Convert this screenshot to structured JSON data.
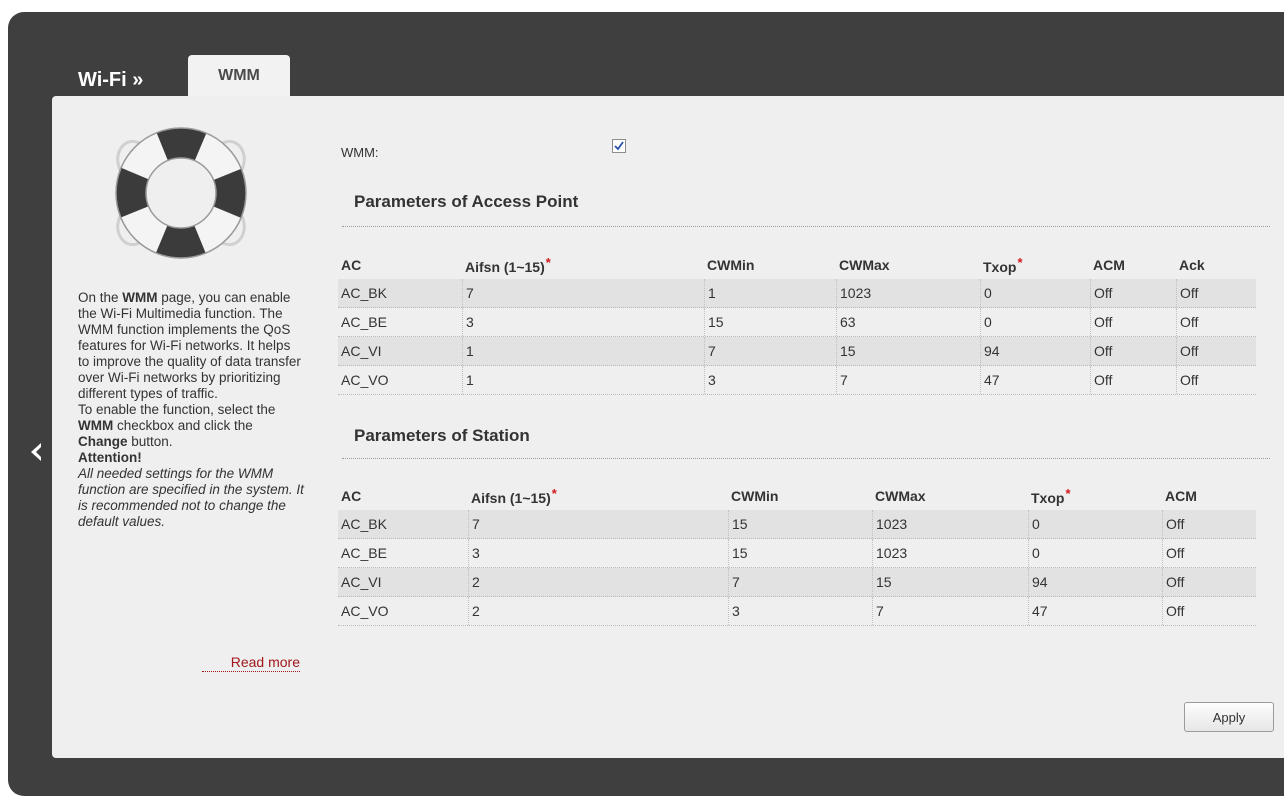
{
  "breadcrumb": {
    "parent": "Wi-Fi »",
    "current_tab": "WMM"
  },
  "help": {
    "p1_before": "On the ",
    "p1_bold": "WMM",
    "p1_after": " page, you can enable the Wi-Fi Multimedia function. The WMM function implements the QoS features for Wi-Fi networks. It helps to improve the quality of data transfer over Wi-Fi networks by prioritizing different types of traffic.",
    "p2_a": "To enable the function, select the ",
    "p2_b": "WMM",
    "p2_c": " checkbox and click the ",
    "p2_d": "Change",
    "p2_e": " button.",
    "attention": "Attention!",
    "note": "All needed settings for the WMM function are specified in the system. It is recommended not to change the default values.",
    "read_more": "Read more"
  },
  "wmm": {
    "label": "WMM:",
    "checked": true
  },
  "access_point": {
    "title": "Parameters of Access Point",
    "headers": [
      "AC",
      "Aifsn (1~15)",
      "CWMin",
      "CWMax",
      "Txop",
      "ACM",
      "Ack"
    ],
    "rows": [
      [
        "AC_BK",
        "7",
        "1",
        "1023",
        "0",
        "Off",
        "Off"
      ],
      [
        "AC_BE",
        "3",
        "15",
        "63",
        "0",
        "Off",
        "Off"
      ],
      [
        "AC_VI",
        "1",
        "7",
        "15",
        "94",
        "Off",
        "Off"
      ],
      [
        "AC_VO",
        "1",
        "3",
        "7",
        "47",
        "Off",
        "Off"
      ]
    ]
  },
  "station": {
    "title": "Parameters of Station",
    "headers": [
      "AC",
      "Aifsn (1~15)",
      "CWMin",
      "CWMax",
      "Txop",
      "ACM"
    ],
    "rows": [
      [
        "AC_BK",
        "7",
        "15",
        "1023",
        "0",
        "Off"
      ],
      [
        "AC_BE",
        "3",
        "15",
        "1023",
        "0",
        "Off"
      ],
      [
        "AC_VI",
        "2",
        "7",
        "15",
        "94",
        "Off"
      ],
      [
        "AC_VO",
        "2",
        "3",
        "7",
        "47",
        "Off"
      ]
    ]
  },
  "apply_label": "Apply",
  "icons": {
    "back": "chevron-left-icon",
    "help_logo": "lifebuoy-icon",
    "required": "asterisk"
  },
  "colors": {
    "frame": "#3f3f3f",
    "panel": "#efefef",
    "link": "#a0181c",
    "required": "#d11a1a"
  }
}
